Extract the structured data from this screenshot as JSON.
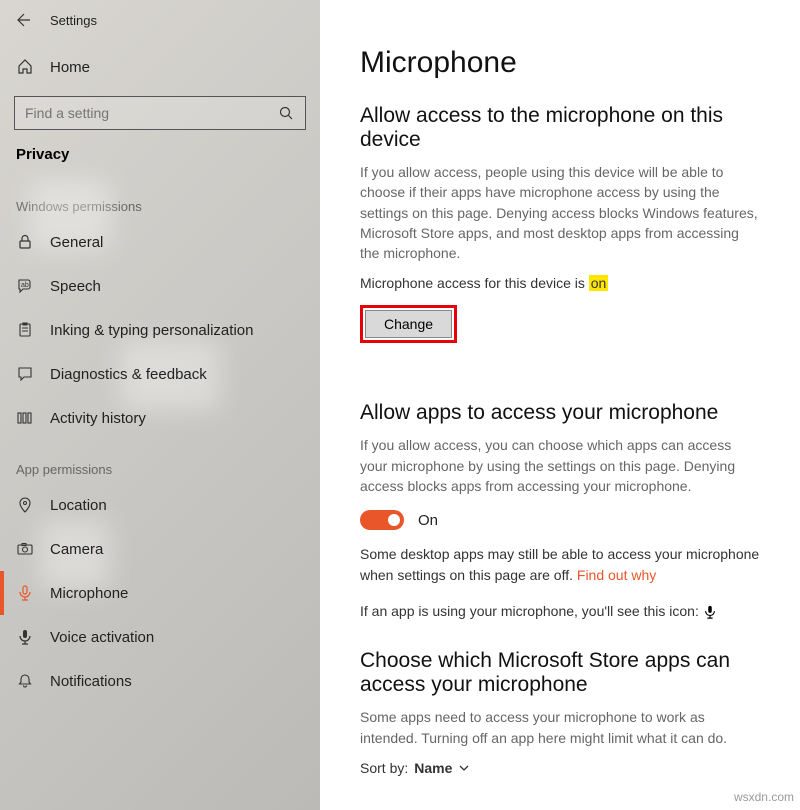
{
  "header": {
    "app_title": "Settings",
    "home_label": "Home"
  },
  "search": {
    "placeholder": "Find a setting"
  },
  "category_label": "Privacy",
  "groups": {
    "windows": {
      "label": "Windows permissions"
    },
    "app": {
      "label": "App permissions"
    }
  },
  "nav": {
    "general": "General",
    "speech": "Speech",
    "inking": "Inking & typing personalization",
    "diag": "Diagnostics & feedback",
    "activity": "Activity history",
    "location": "Location",
    "camera": "Camera",
    "microphone": "Microphone",
    "voice": "Voice activation",
    "notifications": "Notifications"
  },
  "main": {
    "title": "Microphone",
    "section1": {
      "heading": "Allow access to the microphone on this device",
      "desc": "If you allow access, people using this device will be able to choose if their apps have microphone access by using the settings on this page. Denying access blocks Windows features, Microsoft Store apps, and most desktop apps from accessing the microphone.",
      "status_prefix": "Microphone access for this device is ",
      "status_value": "on",
      "change_button": "Change"
    },
    "section2": {
      "heading": "Allow apps to access your microphone",
      "desc": "If you allow access, you can choose which apps can access your microphone by using the settings on this page. Denying access blocks apps from accessing your microphone.",
      "toggle_label": "On",
      "note_a": "Some desktop apps may still be able to access your microphone when settings on this page are off. ",
      "link": "Find out why",
      "note_b": "If an app is using your microphone, you'll see this icon: "
    },
    "section3": {
      "heading": "Choose which Microsoft Store apps can access your microphone",
      "desc": "Some apps need to access your microphone to work as intended. Turning off an app here might limit what it can do.",
      "sort_prefix": "Sort by: ",
      "sort_value": "Name"
    }
  },
  "watermark": "wsxdn.com"
}
